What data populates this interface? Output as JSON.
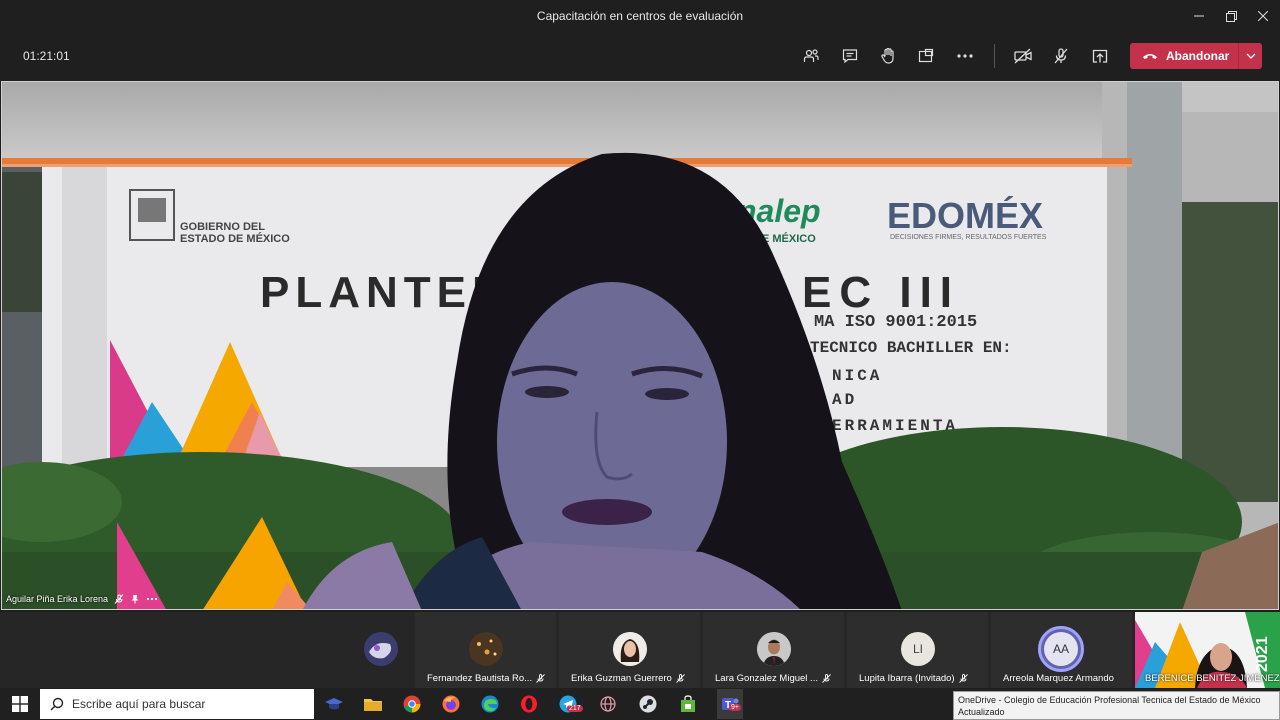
{
  "window": {
    "title": "Capacitación en centros de evaluación"
  },
  "toolbar": {
    "timer": "01:21:01",
    "leave_label": "Abandonar",
    "accent": "#c4314b"
  },
  "stage": {
    "speaker_name": "Aguilar Piña Erika Lorena",
    "background_text": {
      "gov": "GOBIERNO DEL ESTADO DE MÉXICO",
      "conalep": "nalep",
      "conalep_sub": "E MÉXICO",
      "edomex": "EDOMÉX",
      "edomex_sub": "DECISIONES FIRMES, RESULTADOS FUERTES",
      "plantel": "PLANTEL",
      "tec": "EC III",
      "iso": "MA ISO 9001:2015",
      "line1": "TECNICO BACHILLER EN:",
      "line2": "NICA",
      "line3": "AD",
      "line4": "ERRAMIENTA"
    }
  },
  "participants": [
    {
      "name": "",
      "initials": "",
      "muted": false
    },
    {
      "name": "Fernandez Bautista Ro...",
      "initials": "",
      "muted": true
    },
    {
      "name": "Erika Guzman Guerrero",
      "initials": "",
      "muted": true
    },
    {
      "name": "Lara Gonzalez Miguel ...",
      "initials": "",
      "muted": true
    },
    {
      "name": "Lupita Ibarra (Invitado)",
      "initials": "LI",
      "muted": true
    },
    {
      "name": "Arreola Marquez Armando",
      "initials": "AA",
      "muted": false
    },
    {
      "name": "BERENICE BENITEZ JIMENEZ",
      "initials": "",
      "muted": false
    }
  ],
  "taskbar": {
    "search_placeholder": "Escribe aquí para buscar",
    "badges": {
      "telegram": "217",
      "teams": "9+"
    }
  },
  "toast": {
    "line1": "OneDrive - Colegio de Educación Profesional Tecnica del Estado de México",
    "line2": "Actualizado"
  }
}
